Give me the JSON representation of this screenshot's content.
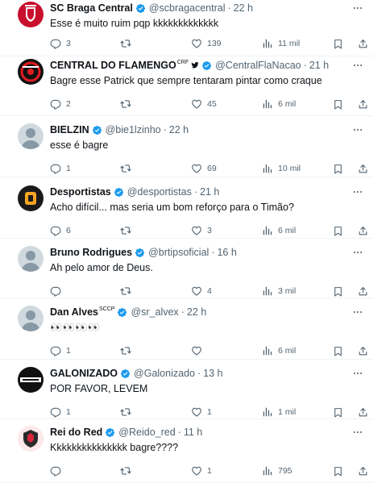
{
  "colors": {
    "text": "#0f1419",
    "secondary": "#536471",
    "verified": "#1d9bf0",
    "divider": "#eff3f4"
  },
  "tweets": [
    {
      "avatar_icon": "sc-braga-crest-icon",
      "name": "SC Braga Central",
      "extra": "",
      "bird": false,
      "handle": "@scbragacentral",
      "dot": "·",
      "time": "22 h",
      "text": "Esse é muito ruim pqp kkkkkkkkkkkkk",
      "replies": "3",
      "retweets": "",
      "likes": "139",
      "views": "11 mil"
    },
    {
      "avatar_icon": "central-do-flamengo-logo-icon",
      "name": "CENTRAL DO FLAMENGO",
      "extra": "CRF",
      "bird": true,
      "handle": "@CentralFlaNacao",
      "dot": "·",
      "time": "21 h",
      "text": "Bagre esse Patrick que sempre tentaram pintar como craque",
      "replies": "2",
      "retweets": "",
      "likes": "45",
      "views": "6 mil"
    },
    {
      "avatar_icon": "user-photo-icon",
      "name": "BIELZIN",
      "extra": "",
      "bird": false,
      "handle": "@bie1lzinho",
      "dot": "·",
      "time": "22 h",
      "text": "esse é bagre",
      "replies": "1",
      "retweets": "",
      "likes": "69",
      "views": "10 mil"
    },
    {
      "avatar_icon": "desportistas-logo-icon",
      "name": "Desportistas",
      "extra": "",
      "bird": false,
      "handle": "@desportistas",
      "dot": "·",
      "time": "21 h",
      "text": "Acho difícil... mas seria um bom reforço para o Timão?",
      "replies": "6",
      "retweets": "",
      "likes": "3",
      "views": "6 mil"
    },
    {
      "avatar_icon": "user-photo-icon",
      "name": "Bruno Rodrigues",
      "extra": "",
      "bird": false,
      "handle": "@brtipsoficial",
      "dot": "·",
      "time": "16 h",
      "text": "Ah pelo amor de Deus.",
      "replies": "",
      "retweets": "",
      "likes": "4",
      "views": "3 mil"
    },
    {
      "avatar_icon": "user-photo-icon",
      "name": "Dan Alves",
      "extra": "SCCP",
      "bird": false,
      "handle": "@sr_alvex",
      "dot": "·",
      "time": "22 h",
      "text": "👀👀👀👀",
      "replies": "1",
      "retweets": "",
      "likes": "",
      "views": "6 mil"
    },
    {
      "avatar_icon": "galonizado-logo-icon",
      "name": "GALONIZADO",
      "extra": "",
      "bird": false,
      "handle": "@Galonizado",
      "dot": "·",
      "time": "13 h",
      "text": "POR FAVOR, LEVEM",
      "replies": "1",
      "retweets": "",
      "likes": "1",
      "views": "1 mil"
    },
    {
      "avatar_icon": "rei-do-red-logo-icon",
      "name": "Rei do Red",
      "extra": "",
      "bird": false,
      "handle": "@Reido_red",
      "dot": "·",
      "time": "11 h",
      "text": "Kkkkkkkkkkkkkkk bagre????",
      "replies": "",
      "retweets": "",
      "likes": "1",
      "views": "795"
    }
  ]
}
